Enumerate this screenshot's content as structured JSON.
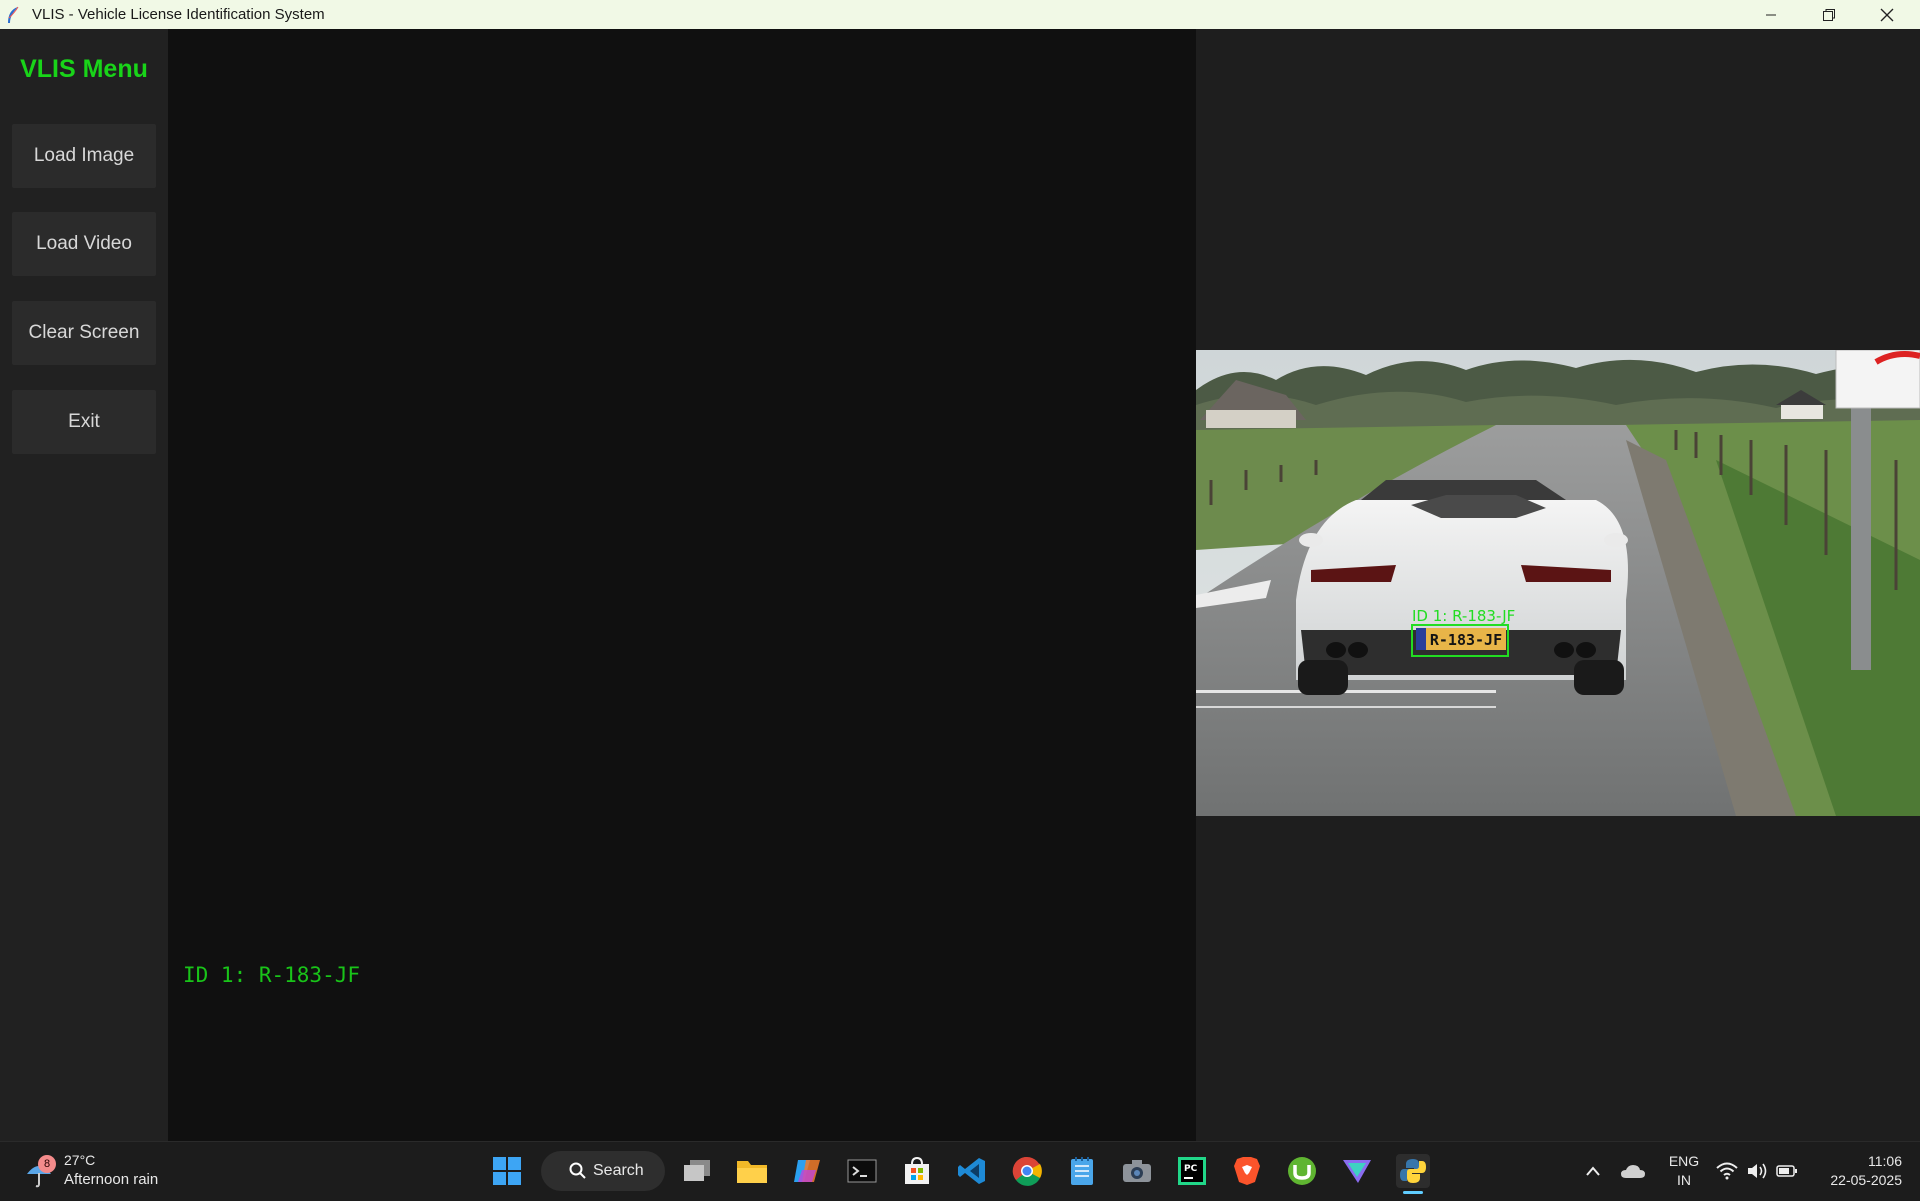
{
  "window": {
    "title": "VLIS - Vehicle License Identification System"
  },
  "sidebar": {
    "title": "VLIS Menu",
    "buttons": [
      {
        "label": "Load Image"
      },
      {
        "label": "Load Video"
      },
      {
        "label": "Clear Screen"
      },
      {
        "label": "Exit"
      }
    ]
  },
  "results": {
    "text": "ID 1: R-183-JF"
  },
  "video": {
    "overlay_label": "ID 1: R-183-JF",
    "plate_text": "R-183-JF",
    "box_color": "#22dd22"
  },
  "taskbar": {
    "weather": {
      "temp": "27°C",
      "condition": "Afternoon rain",
      "badge": "8"
    },
    "search_label": "Search",
    "apps": [
      "start-icon",
      "search",
      "task-view-icon",
      "file-explorer-icon",
      "copilot-icon",
      "terminal-icon",
      "store-icon",
      "vscode-icon",
      "chrome-icon",
      "notepad-icon",
      "camera-icon",
      "pycharm-icon",
      "brave-icon",
      "utorrent-icon",
      "proton-vpn-icon",
      "python-icon"
    ],
    "language": {
      "line1": "ENG",
      "line2": "IN"
    },
    "clock": {
      "time": "11:06",
      "date": "22-05-2025"
    }
  },
  "colors": {
    "accent_green": "#19d419",
    "sidebar_bg": "#212121",
    "panel_bg": "#101010",
    "button_bg": "#2b2b2b"
  }
}
